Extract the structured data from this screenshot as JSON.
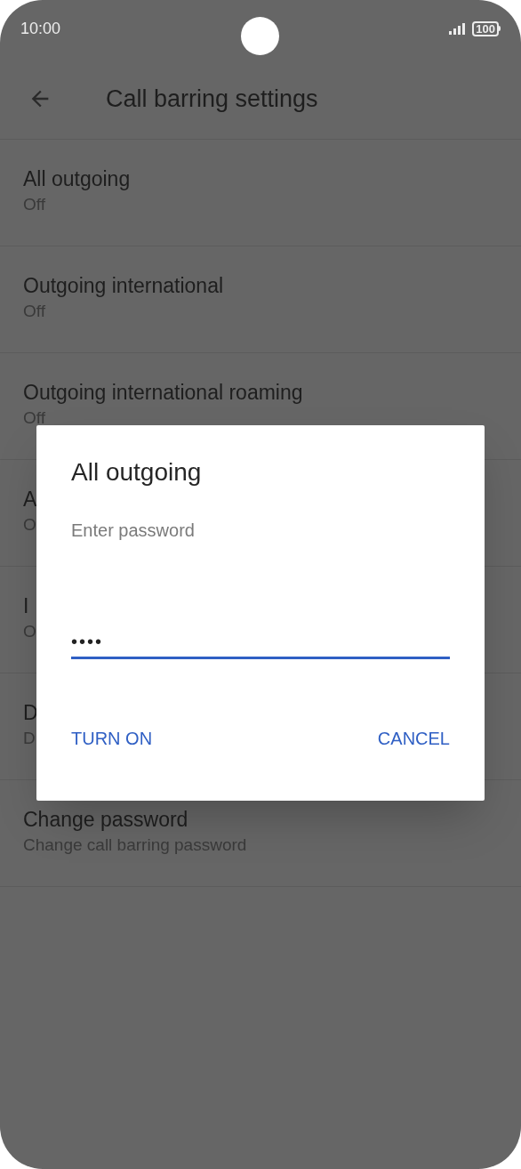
{
  "status_bar": {
    "time": "10:00",
    "battery": "100"
  },
  "app_bar": {
    "title": "Call barring settings"
  },
  "settings": [
    {
      "title": "All outgoing",
      "summary": "Off"
    },
    {
      "title": "Outgoing international",
      "summary": "Off"
    },
    {
      "title": "Outgoing international roaming",
      "summary": "Off"
    },
    {
      "title": "A",
      "summary": "O"
    },
    {
      "title": "I",
      "summary": "O"
    },
    {
      "title": "D",
      "summary": "D"
    },
    {
      "title": "Change password",
      "summary": "Change call barring password"
    }
  ],
  "dialog": {
    "title": "All outgoing",
    "field_label": "Enter password",
    "value": "••••",
    "buttons": [
      "TURN ON",
      "CANCEL"
    ]
  }
}
